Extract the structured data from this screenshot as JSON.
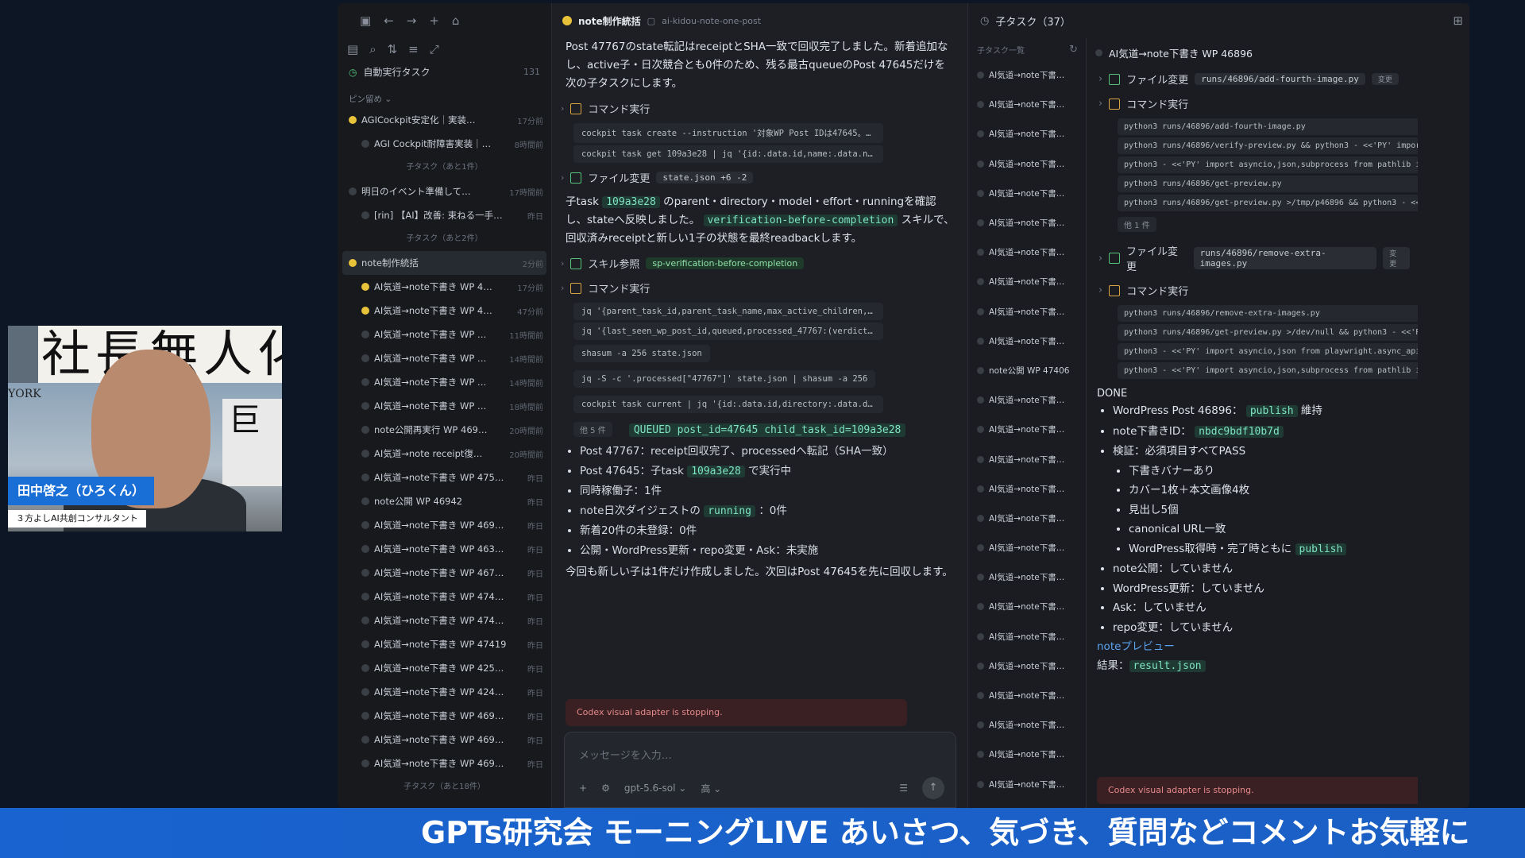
{
  "toolbar_icons": [
    "sidebar-icon",
    "back-icon",
    "forward-icon",
    "plus-icon",
    "folder-icon"
  ],
  "sidebar": {
    "auto_task": {
      "label": "自動実行タスク",
      "count": "131"
    },
    "pinned_header": "ピン留め ⌄",
    "items": [
      {
        "label": "AGICockpit安定化｜実装…",
        "time": "17分前",
        "dot": "y",
        "indent": false
      },
      {
        "label": "AGI Cockpit耐障害実装｜…",
        "time": "8時間前",
        "dot": "",
        "indent": true
      },
      {
        "label": "明日のイベント準備して…",
        "time": "17時間前",
        "dot": "",
        "indent": false
      },
      {
        "label": "[rin] 【AI】改善: 束ねる一手…",
        "time": "昨日",
        "dot": "",
        "indent": true
      },
      {
        "label": "note制作統括",
        "time": "2分前",
        "dot": "y",
        "indent": false,
        "sel": true
      },
      {
        "label": "AI気道→note下書き WP 4…",
        "time": "17分前",
        "dot": "y",
        "indent": true
      },
      {
        "label": "AI気道→note下書き WP 4…",
        "time": "47分前",
        "dot": "y",
        "indent": true
      },
      {
        "label": "AI気道→note下書き WP …",
        "time": "11時間前",
        "dot": "",
        "indent": true
      },
      {
        "label": "AI気道→note下書き WP …",
        "time": "14時間前",
        "dot": "",
        "indent": true
      },
      {
        "label": "AI気道→note下書き WP …",
        "time": "14時間前",
        "dot": "",
        "indent": true
      },
      {
        "label": "AI気道→note下書き WP …",
        "time": "18時間前",
        "dot": "",
        "indent": true
      },
      {
        "label": "note公開再実行 WP 469…",
        "time": "20時間前",
        "dot": "",
        "indent": true
      },
      {
        "label": "AI気道→note receipt復…",
        "time": "20時間前",
        "dot": "",
        "indent": true
      },
      {
        "label": "AI気道→note下書き WP 475…",
        "time": "昨日",
        "dot": "",
        "indent": true
      },
      {
        "label": "note公開 WP 46942",
        "time": "昨日",
        "dot": "",
        "indent": true
      },
      {
        "label": "AI気道→note下書き WP 469…",
        "time": "昨日",
        "dot": "",
        "indent": true
      },
      {
        "label": "AI気道→note下書き WP 463…",
        "time": "昨日",
        "dot": "",
        "indent": true
      },
      {
        "label": "AI気道→note下書き WP 467…",
        "time": "昨日",
        "dot": "",
        "indent": true
      },
      {
        "label": "AI気道→note下書き WP 474…",
        "time": "昨日",
        "dot": "",
        "indent": true
      },
      {
        "label": "AI気道→note下書き WP 474…",
        "time": "昨日",
        "dot": "",
        "indent": true
      },
      {
        "label": "AI気道→note下書き WP 47419",
        "time": "昨日",
        "dot": "",
        "indent": true
      },
      {
        "label": "AI気道→note下書き WP 425…",
        "time": "昨日",
        "dot": "",
        "indent": true
      },
      {
        "label": "AI気道→note下書き WP 424…",
        "time": "昨日",
        "dot": "",
        "indent": true
      },
      {
        "label": "AI気道→note下書き WP 469…",
        "time": "昨日",
        "dot": "",
        "indent": true
      },
      {
        "label": "AI気道→note下書き WP 469…",
        "time": "昨日",
        "dot": "",
        "indent": true
      },
      {
        "label": "AI気道→note下書き WP 469…",
        "time": "昨日",
        "dot": "",
        "indent": true
      }
    ],
    "subnote_1": "子タスク（あと1件）",
    "subnote_2": "子タスク（あと2件）",
    "subnote_3": "子タスク（あと18件）"
  },
  "chat": {
    "title": "note制作統括",
    "path": "ai-kidou-note-one-post",
    "intro": "Post 47767のstate転記はreceiptとSHA一致で回収完了しました。新着追加なし、active子・日次競合とも0件のため、残る最古queueのPost 47645だけを次の子タスクにします。",
    "cmd_label": "コマンド実行",
    "cmds1": [
      "cockpit task create --instruction '対象WP Post IDは47645。URLはhttps://ai-…",
      "cockpit task get 109a3e28 | jq '{id:.data.id,name:.data.name,status:.data.sta…"
    ],
    "file_label": "ファイル変更",
    "file_chip": "state.json +6 -2",
    "para_a": "子task",
    "para_code": "109a3e28",
    "para_b": "のparent・directory・model・effort・runningを確認し、stateへ反映しました。",
    "para_code2": "verification-before-completion",
    "para_c": "スキルで、回収済みreceiptと新しい1子の状態を最終readbackします。",
    "skill_label": "スキル参照",
    "skill_chip": "sp-verification-before-completion",
    "cmds2": [
      "jq '{parent_task_id,parent_task_name,max_active_children,resource_key}' s…",
      "jq '{last_seen_wp_post_id,queued,processed_47767:(verdict:.processed[\"4…",
      "shasum -a 256 state.json",
      "jq -S -c '.processed[\"47767\"]' state.json | shasum -a 256",
      "cockpit task current | jq '{id:.data.id,directory:.data.directory,status:.data.sta…"
    ],
    "more": "他 5 件",
    "queued": "QUEUED post_id=47645 child_task_id=109a3e28",
    "b1": "Post 47767：receipt回収完了、processedへ転記（SHA一致）",
    "b2a": "Post 47645：子task",
    "b2code": "109a3e28",
    "b2b": "で実行中",
    "b3": "同時稼働子：1件",
    "b4a": "note日次ダイジェストの",
    "b4code": "running",
    "b4b": "：0件",
    "b5": "新着20件の未登録：0件",
    "b6": "公開・WordPress更新・repo変更・Ask：未実施",
    "outro": "今回も新しい子は1件だけ作成しました。次回はPost 47645を先に回収します。",
    "error": "Codex visual adapter is stopping.",
    "input_placeholder": "メッセージを入力…",
    "model": "gpt-5.6-sol ⌄",
    "effort": "高 ⌄"
  },
  "subtasks": {
    "title": "子タスク（37）",
    "list_header": "子タスク一覧",
    "items": [
      "AI気道→note下書…",
      "AI気道→note下書…",
      "AI気道→note下書…",
      "AI気道→note下書…",
      "AI気道→note下書…",
      "AI気道→note下書…",
      "AI気道→note下書…",
      "AI気道→note下書…",
      "AI気道→note下書…",
      "AI気道→note下書…",
      "note公開 WP 47406",
      "AI気道→note下書…",
      "AI気道→note下書…",
      "AI気道→note下書…",
      "AI気道→note下書…",
      "AI気道→note下書…",
      "AI気道→note下書…",
      "AI気道→note下書…",
      "AI気道→note下書…",
      "AI気道→note下書…",
      "AI気道→note下書…",
      "AI気道→note下書…",
      "AI気道→note下書…",
      "AI気道→note下書…",
      "AI気道→note下書…"
    ],
    "detail_title": "AI気道→note下書き WP 46896",
    "file1": "runs/46896/add-fourth-image.py",
    "change": "変更",
    "cmd_label": "コマンド実行",
    "file_label": "ファイル変更",
    "cmdsA": [
      "python3 runs/46896/add-fourth-image.py",
      "python3 runs/46896/verify-preview.py && python3 - <<'PY' import asyncio,js…",
      "python3 - <<'PY' import asyncio,json,subprocess from pathlib import Path fr…",
      "python3 runs/46896/get-preview.py",
      "python3 runs/46896/get-preview.py >/tmp/p46896 && python3 - <<'PY' imp…"
    ],
    "moreA": "他 1 件",
    "file2": "runs/46896/remove-extra-images.py",
    "cmdsB": [
      "python3 runs/46896/remove-extra-images.py",
      "python3 runs/46896/get-preview.py >/dev/null && python3 - <<'PY' import a…",
      "python3 - <<'PY' import asyncio,json from playwright.async_api import asyn…",
      "python3 - <<'PY' import asyncio,json,subprocess from pathlib import Path fr…"
    ],
    "done": "DONE",
    "d1a": "WordPress Post 46896：",
    "d1code": "publish",
    "d1b": "維持",
    "d2a": "note下書きID：",
    "d2code": "nbdc9bdf10b7d",
    "d3": "検証：必須項目すべてPASS",
    "d3s": [
      "下書きバナーあり",
      "カバー1枚＋本文画像4枚",
      "見出し5個",
      "canonical URL一致"
    ],
    "d3s5a": "WordPress取得時・完了時ともに",
    "d3s5code": "publish",
    "d4": "note公開：していません",
    "d5": "WordPress更新：していません",
    "d6": "Ask：していません",
    "d7": "repo変更：していません",
    "preview": "noteプレビュー",
    "result_a": "結果：",
    "result_code": "result.json",
    "error": "Codex visual adapter is stopping."
  },
  "webcam": {
    "sign": "社長無人化",
    "york": "YORK",
    "name": "田中啓之（ひろくん）",
    "subtitle": "３方よしAI共創コンサルタント"
  },
  "ticker": "GPTs研究会 モーニングLIVE あいさつ、気づき、質問などコメントお気軽に",
  "colors": {
    "accent_green": "#7fe3c4",
    "dot_yellow": "#e8c33a",
    "ticker_blue": "#1863cf",
    "link_blue": "#5aa3f0",
    "error_bg": "#3a1f23"
  }
}
